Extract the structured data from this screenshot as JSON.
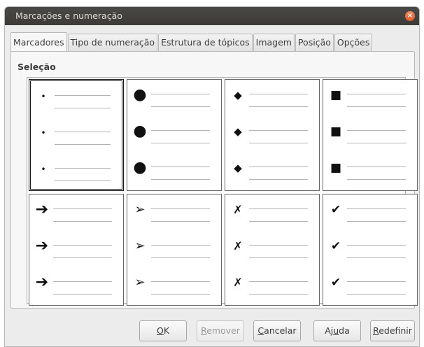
{
  "window": {
    "title": "Marcações e numeração",
    "close_icon": "×"
  },
  "tabs": [
    {
      "label": "Marcadores",
      "active": true
    },
    {
      "label": "Tipo de numeração"
    },
    {
      "label": "Estrutura de tópicos"
    },
    {
      "label": "Imagem"
    },
    {
      "label": "Posição"
    },
    {
      "label": "Opções"
    }
  ],
  "section": {
    "title": "Seleção"
  },
  "bullets": [
    {
      "name": "small-dot",
      "symbol": "•",
      "selected": true
    },
    {
      "name": "large-dot",
      "symbol": "●"
    },
    {
      "name": "diamond",
      "symbol": "◆"
    },
    {
      "name": "square",
      "symbol": "■"
    },
    {
      "name": "arrow",
      "symbol": "➔"
    },
    {
      "name": "arrowhead",
      "symbol": "➢"
    },
    {
      "name": "x-mark",
      "symbol": "✗"
    },
    {
      "name": "check-mark",
      "symbol": "✔"
    }
  ],
  "buttons": {
    "ok": {
      "pre": "",
      "u": "O",
      "post": "K"
    },
    "remover": {
      "pre": "",
      "u": "R",
      "post": "emover",
      "disabled": true
    },
    "cancelar": {
      "pre": "",
      "u": "C",
      "post": "ancelar"
    },
    "ajuda": {
      "pre": "Aj",
      "u": "u",
      "post": "da"
    },
    "redefinir": {
      "pre": "",
      "u": "R",
      "post": "edefinir"
    }
  }
}
